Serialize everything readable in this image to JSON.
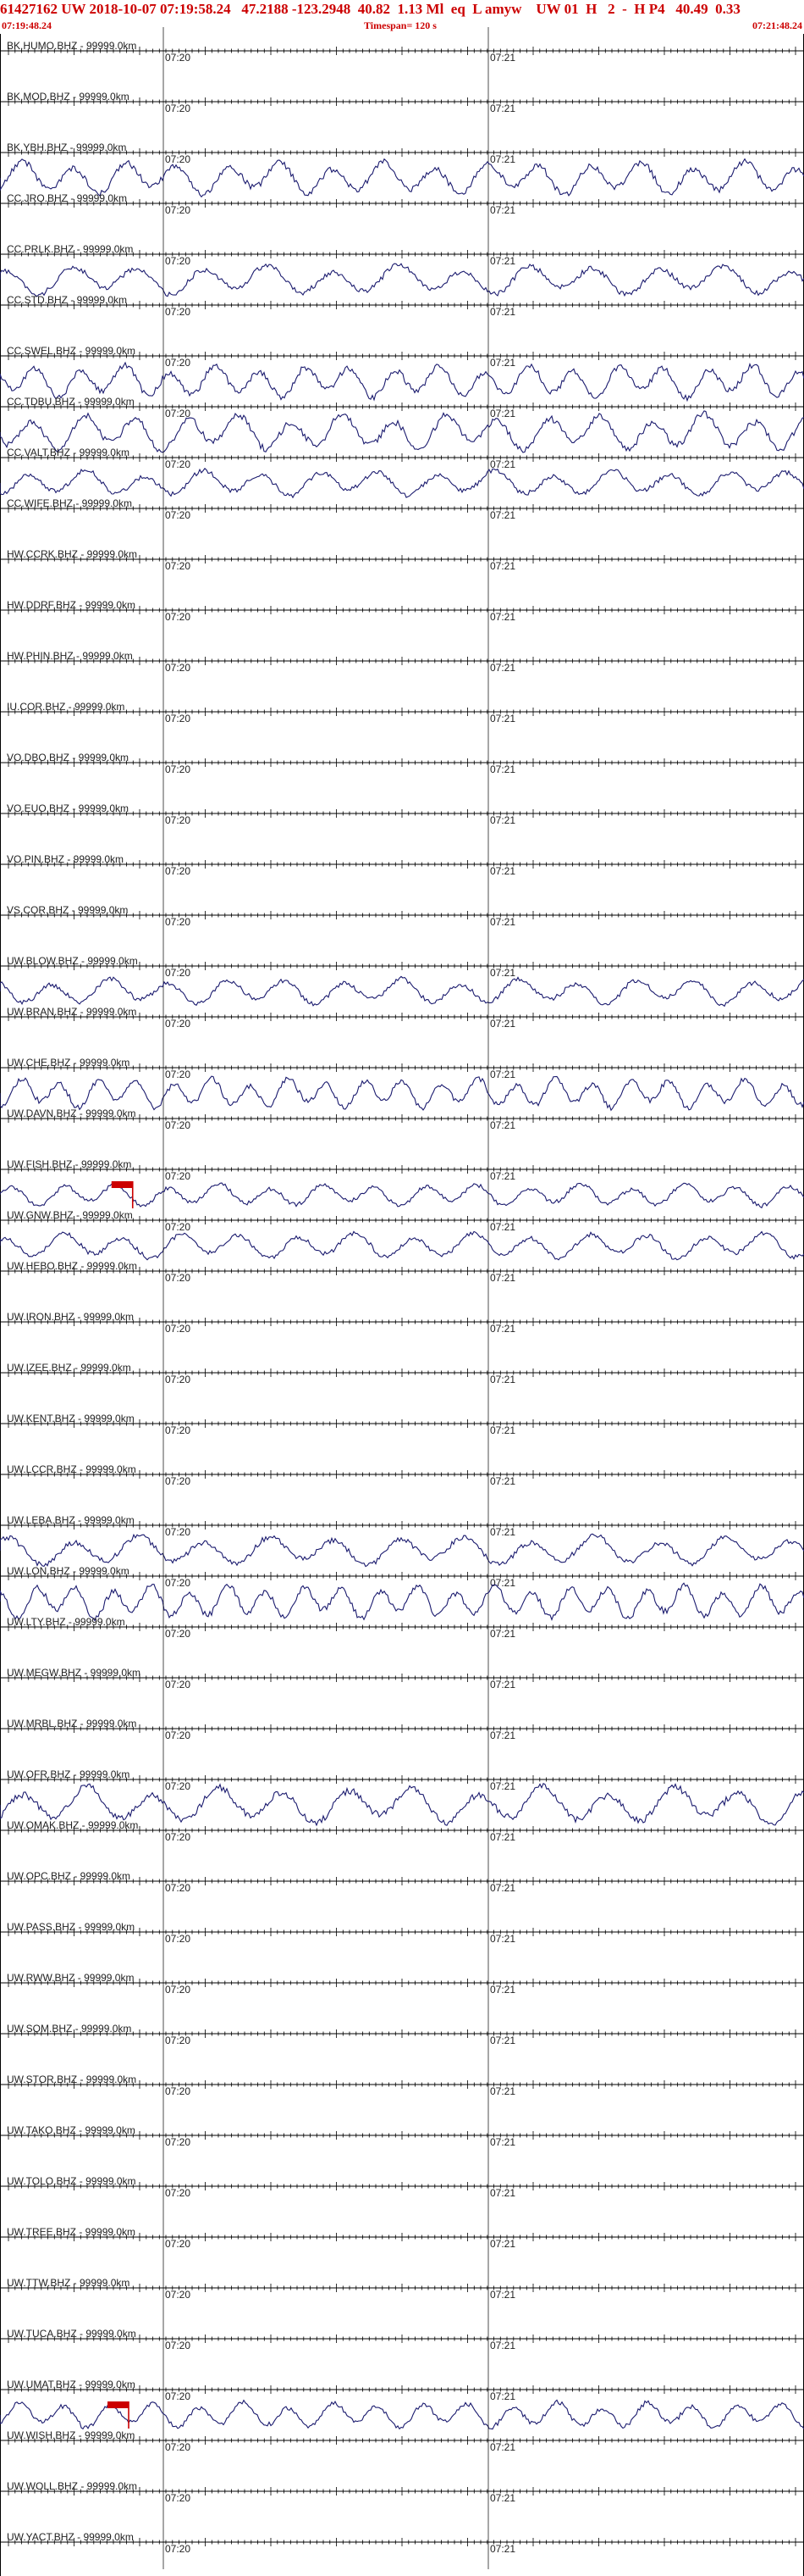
{
  "header": {
    "title": "61427162 UW 2018-10-07 07:19:58.24   47.2188 -123.2948  40.82  1.13 Ml  eq  L amyw    UW 01  H   2  -  H P4   40.49  0.33",
    "start_time": "07:19:48.24",
    "timespan": "Timespan= 120 s",
    "end_time": "07:21:48.24"
  },
  "time_labels": {
    "first": "07:20",
    "second": "07:21"
  },
  "colors": {
    "trace": "#1a1a6e",
    "header": "#cc0000",
    "pick": "#cc0000",
    "axis": "#000000"
  },
  "channels": [
    {
      "label": "BK.HUMO.BHZ - 99999.0km",
      "amp": 0
    },
    {
      "label": "BK.MOD.BHZ - 99999.0km",
      "amp": 0
    },
    {
      "label": "BK.YBH.BHZ - 99999.0km",
      "amp": 0.9
    },
    {
      "label": "CC.JRO.BHZ - 99999.0km",
      "amp": 0
    },
    {
      "label": "CC.PRLK.BHZ - 99999.0km",
      "amp": 0.8
    },
    {
      "label": "CC.STD.BHZ - 99999.0km",
      "amp": 0
    },
    {
      "label": "CC.SWEL.BHZ - 99999.0km",
      "amp": 0.9
    },
    {
      "label": "CC.TDBU.BHZ - 99999.0km",
      "amp": 1
    },
    {
      "label": "CC.VALT.BHZ - 99999.0km",
      "amp": 0.7
    },
    {
      "label": "CC.WIFE.BHZ - 99999.0km",
      "amp": 0
    },
    {
      "label": "HW.CCRK.BHZ - 99999.0km",
      "amp": 0
    },
    {
      "label": "HW.DDRF.BHZ - 99999.0km",
      "amp": 0
    },
    {
      "label": "HW.PHIN.BHZ - 99999.0km",
      "amp": 0
    },
    {
      "label": "IU.COR.BHZ - 99999.0km",
      "amp": 0
    },
    {
      "label": "VO.DBO.BHZ - 99999.0km",
      "amp": 0
    },
    {
      "label": "VO.EUO.BHZ - 99999.0km",
      "amp": 0
    },
    {
      "label": "VO.PIN.BHZ - 99999.0km",
      "amp": 0
    },
    {
      "label": "VS.COR.BHZ - 99999.0km",
      "amp": 0
    },
    {
      "label": "UW.BLOW.BHZ - 99999.0km",
      "amp": 0.7
    },
    {
      "label": "UW.BRAN.BHZ - 99999.0km",
      "amp": 0
    },
    {
      "label": "UW.CHE.BHZ - 99999.0km",
      "amp": 0.8
    },
    {
      "label": "UW.DAVN.BHZ - 99999.0km",
      "amp": 0
    },
    {
      "label": "UW.FISH.BHZ - 99999.0km",
      "amp": 0.6,
      "pick": 0.165
    },
    {
      "label": "UW.GNW.BHZ - 99999.0km",
      "amp": 0.7
    },
    {
      "label": "UW.HEBO.BHZ - 99999.0km",
      "amp": 0
    },
    {
      "label": "UW.IRON.BHZ - 99999.0km",
      "amp": 0
    },
    {
      "label": "UW.IZEE.BHZ - 99999.0km",
      "amp": 0
    },
    {
      "label": "UW.KENT.BHZ - 99999.0km",
      "amp": 0
    },
    {
      "label": "UW.LCCR.BHZ - 99999.0km",
      "amp": 0
    },
    {
      "label": "UW.LEBA.BHZ - 99999.0km",
      "amp": 0.8
    },
    {
      "label": "UW.LON.BHZ - 99999.0km",
      "amp": 0.9
    },
    {
      "label": "UW.LTY.BHZ - 99999.0km",
      "amp": 0
    },
    {
      "label": "UW.MEGW.BHZ - 99999.0km",
      "amp": 0
    },
    {
      "label": "UW.MRBL.BHZ - 99999.0km",
      "amp": 0
    },
    {
      "label": "UW.OFR.BHZ - 99999.0km",
      "amp": 1
    },
    {
      "label": "UW.OMAK.BHZ - 99999.0km",
      "amp": 0
    },
    {
      "label": "UW.OPC.BHZ - 99999.0km",
      "amp": 0
    },
    {
      "label": "UW.PASS.BHZ - 99999.0km",
      "amp": 0
    },
    {
      "label": "UW.RWW.BHZ - 99999.0km",
      "amp": 0
    },
    {
      "label": "UW.SQM.BHZ - 99999.0km",
      "amp": 0
    },
    {
      "label": "UW.STOR.BHZ - 99999.0km",
      "amp": 0
    },
    {
      "label": "UW.TAKO.BHZ - 99999.0km",
      "amp": 0
    },
    {
      "label": "UW.TOLO.BHZ - 99999.0km",
      "amp": 0
    },
    {
      "label": "UW.TREE.BHZ - 99999.0km",
      "amp": 0
    },
    {
      "label": "UW.TTW.BHZ - 99999.0km",
      "amp": 0
    },
    {
      "label": "UW.TUCA.BHZ - 99999.0km",
      "amp": 0
    },
    {
      "label": "UW.UMAT.BHZ - 99999.0km",
      "amp": 0.7,
      "pick": 0.16
    },
    {
      "label": "UW.WISH.BHZ - 99999.0km",
      "amp": 0
    },
    {
      "label": "UW.WOLL.BHZ - 99999.0km",
      "amp": 0
    },
    {
      "label": "UW.YACT.BHZ - 99999.0km",
      "amp": 0
    }
  ]
}
